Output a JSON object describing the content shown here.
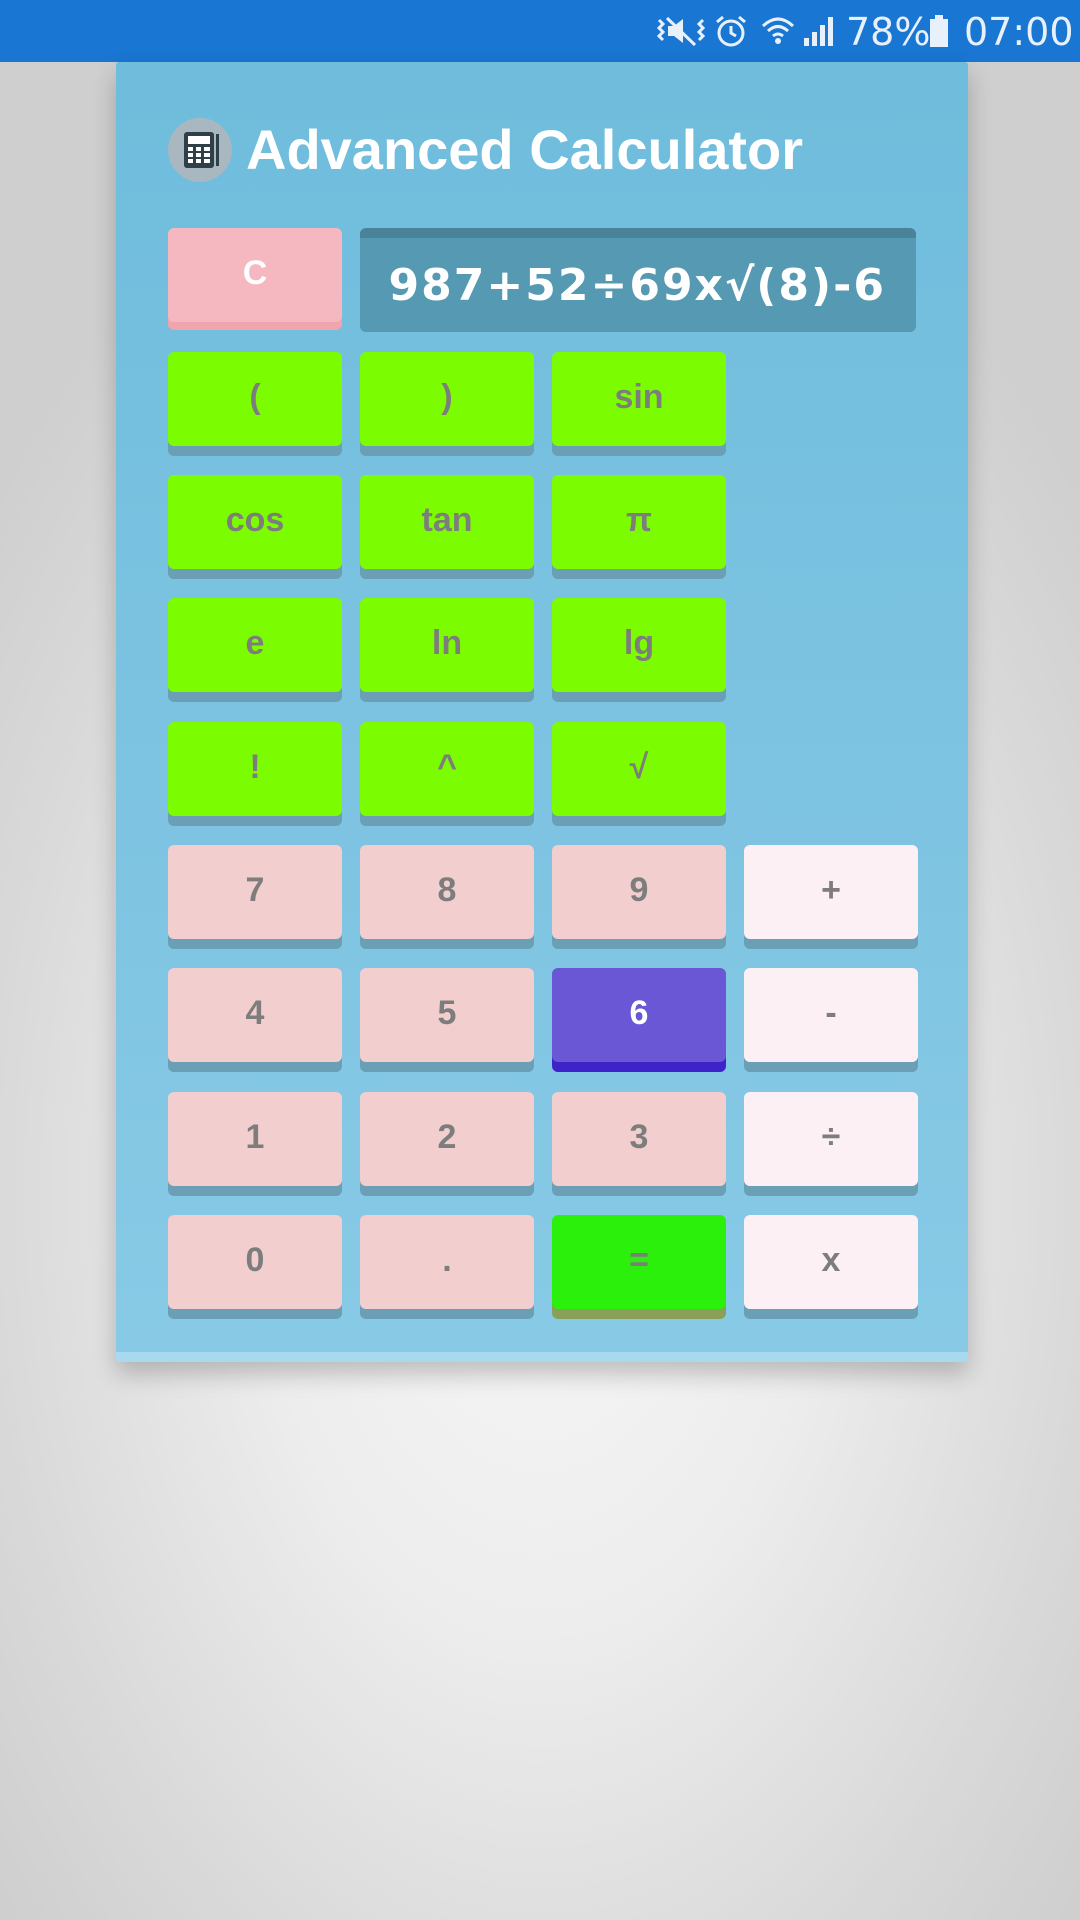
{
  "status_bar": {
    "battery_percent": "78%",
    "time": "07:00",
    "icons": [
      "mute-vibrate-icon",
      "alarm-icon",
      "wifi-icon",
      "signal-icon",
      "battery-icon"
    ]
  },
  "app": {
    "title": "Advanced Calculator",
    "icon": "calculator-icon",
    "display_expression": "987+52÷69x√(8)-6"
  },
  "colors": {
    "status_bar": "#1976d2",
    "function_key": "#7cfc00",
    "number_key": "#f2cece",
    "operator_key": "#fdf0f4",
    "clear_key": "#f6b8c0",
    "pressed_key": "#6a57d6",
    "equals_key": "#2bf00c",
    "display": "#5599b2"
  },
  "keys": {
    "clear": "C",
    "open_paren": "(",
    "close_paren": ")",
    "sin": "sin",
    "cos": "cos",
    "tan": "tan",
    "pi": "π",
    "e": "e",
    "ln": "ln",
    "lg": "lg",
    "factorial": "!",
    "power": "^",
    "sqrt": "√",
    "seven": "7",
    "eight": "8",
    "nine": "9",
    "plus": "+",
    "four": "4",
    "five": "5",
    "six": "6",
    "minus": "-",
    "one": "1",
    "two": "2",
    "three": "3",
    "divide": "÷",
    "zero": "0",
    "dot": ".",
    "equals": "=",
    "multiply": "x"
  }
}
